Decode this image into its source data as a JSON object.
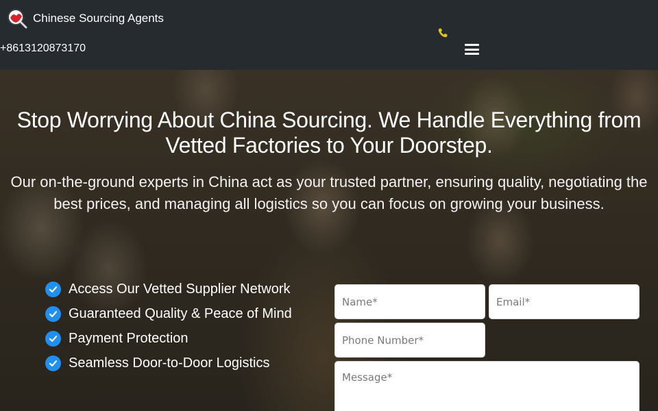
{
  "header": {
    "brand": "Chinese Sourcing Agents",
    "phone": "+8613120873170",
    "icons": {
      "logo": "magnifier-logo-icon",
      "phone": "phone-icon",
      "menu": "hamburger-menu-icon"
    },
    "phone_icon_color": "#e5c21c"
  },
  "hero": {
    "headline": "Stop Worrying About China Sourcing. We Handle Everything from Vetted Factories to Your Doorstep.",
    "subhead": "Our on-the-ground experts in China act as your trusted partner, ensuring quality, negotiating the best prices, and managing all logistics so you can focus on growing your business.",
    "features": [
      "Access Our Vetted Supplier Network",
      "Guaranteed Quality & Peace of Mind",
      "Payment Protection",
      "Seamless Door-to-Door Logistics"
    ],
    "check_color": "#1f8ff0"
  },
  "form": {
    "name_placeholder": "Name*",
    "email_placeholder": "Email*",
    "phone_placeholder": "Phone Number*",
    "message_placeholder": "Message*"
  }
}
